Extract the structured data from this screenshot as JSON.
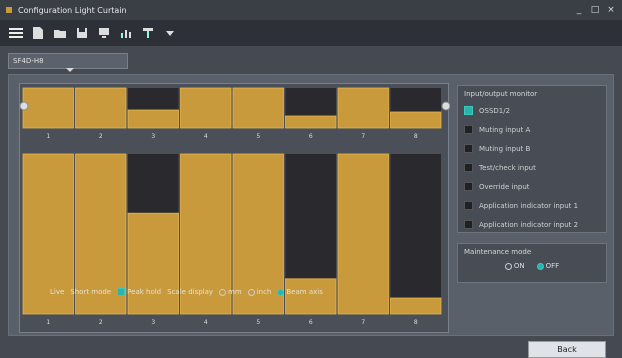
{
  "window": {
    "title": "Configuration Light Curtain",
    "minimize": "_",
    "maximize": "□",
    "close": "×"
  },
  "toolbar": {
    "icons": [
      "menu-icon",
      "file-icon",
      "folder-icon",
      "save-icon",
      "device-icon",
      "chart-icon",
      "export-icon",
      "dropdown-icon"
    ]
  },
  "tab": {
    "label": "SF4D-H8"
  },
  "upper_bars": {
    "labels": [
      "1",
      "2",
      "3",
      "4",
      "5",
      "6",
      "7",
      "8"
    ],
    "fill": [
      1.0,
      1.0,
      0.45,
      1.0,
      1.0,
      0.3,
      1.0,
      0.4
    ]
  },
  "lower_bars": {
    "labels": [
      "1",
      "2",
      "3",
      "4",
      "5",
      "6",
      "7",
      "8"
    ],
    "fill": [
      1.0,
      1.0,
      0.63,
      1.0,
      1.0,
      0.22,
      1.0,
      0.1
    ]
  },
  "controls": {
    "label_prefix": "Live",
    "monitor_mode": "Short mode",
    "peak_hold": "Peak hold",
    "scale_display": "Scale display",
    "opt_mm": "mm",
    "opt_inch": "inch",
    "opt_beam": "Beam axis"
  },
  "monitor": {
    "title": "Input/output monitor",
    "items": [
      {
        "label": "OSSD1/2",
        "on": true
      },
      {
        "label": "Muting input A",
        "on": false
      },
      {
        "label": "Muting input B",
        "on": false
      },
      {
        "label": "Test/check input",
        "on": false
      },
      {
        "label": "Override input",
        "on": false
      },
      {
        "label": "Application indicator input 1",
        "on": false
      },
      {
        "label": "Application indicator input 2",
        "on": false
      }
    ]
  },
  "maintenance": {
    "title": "Maintenance mode",
    "on_label": "ON",
    "off_label": "OFF",
    "selected": "OFF"
  },
  "back_label": "Back",
  "colors": {
    "bar_fill": "#c99a3c",
    "bar_dark": "#2a2a2e",
    "accent": "#2fb3a8"
  }
}
